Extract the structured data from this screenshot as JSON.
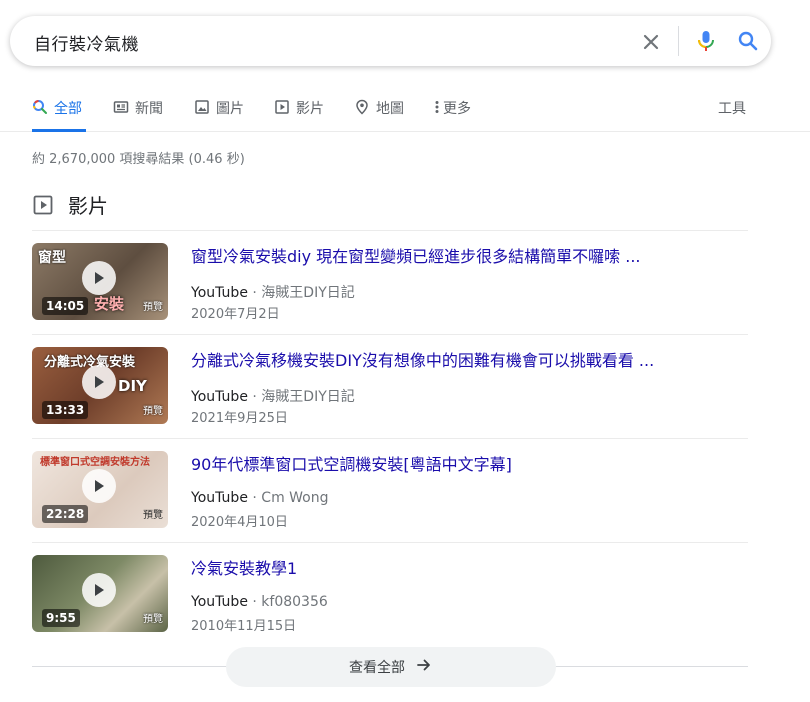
{
  "search": {
    "query": "自行裝冷氣機"
  },
  "tabs": [
    {
      "label": "全部",
      "icon": "search-icon",
      "active": true
    },
    {
      "label": "新聞",
      "icon": "news-icon"
    },
    {
      "label": "圖片",
      "icon": "image-icon"
    },
    {
      "label": "影片",
      "icon": "video-icon"
    },
    {
      "label": "地圖",
      "icon": "map-pin-icon"
    },
    {
      "label": "更多",
      "icon": "more-vert-icon"
    }
  ],
  "tools_label": "工具",
  "stats": "約 2,670,000 項搜尋結果 (0.46 秒)",
  "videos_heading": "影片",
  "results": [
    {
      "title": "窗型冷氣安裝diy 現在窗型變頻已經進步很多結構簡單不囉嗦 ...",
      "source": "YouTube",
      "channel": "海賊王DIY日記",
      "date": "2020年7月2日",
      "duration": "14:05",
      "thumb_text": "窗型",
      "thumb_text2": "安裝",
      "thumb_preview": "預覽",
      "thumb_color": "#7a6a5a"
    },
    {
      "title": "分離式冷氣移機安裝DIY沒有想像中的困難有機會可以挑戰看看 ...",
      "source": "YouTube",
      "channel": "海賊王DIY日記",
      "date": "2021年9月25日",
      "duration": "13:33",
      "thumb_text": "分離式冷氣安裝",
      "thumb_text2": "DIY",
      "thumb_preview": "預覽",
      "thumb_color": "#8a5a3c"
    },
    {
      "title": "90年代標準窗口式空調機安裝[粵語中文字幕]",
      "source": "YouTube",
      "channel": "Cm Wong",
      "date": "2020年4月10日",
      "duration": "22:28",
      "thumb_text": "標準窗口式空調安裝方法",
      "thumb_text2": "",
      "thumb_preview": "預覽",
      "thumb_color": "#e9dcd2"
    },
    {
      "title": "冷氣安裝教學1",
      "source": "YouTube",
      "channel": "kf080356",
      "date": "2010年11月15日",
      "duration": "9:55",
      "thumb_text": "",
      "thumb_text2": "",
      "thumb_preview": "預覽",
      "thumb_color": "#6b7a5a"
    }
  ],
  "see_all_label": "查看全部",
  "colors": {
    "link": "#1a0dab",
    "accent": "#1a73e8"
  }
}
